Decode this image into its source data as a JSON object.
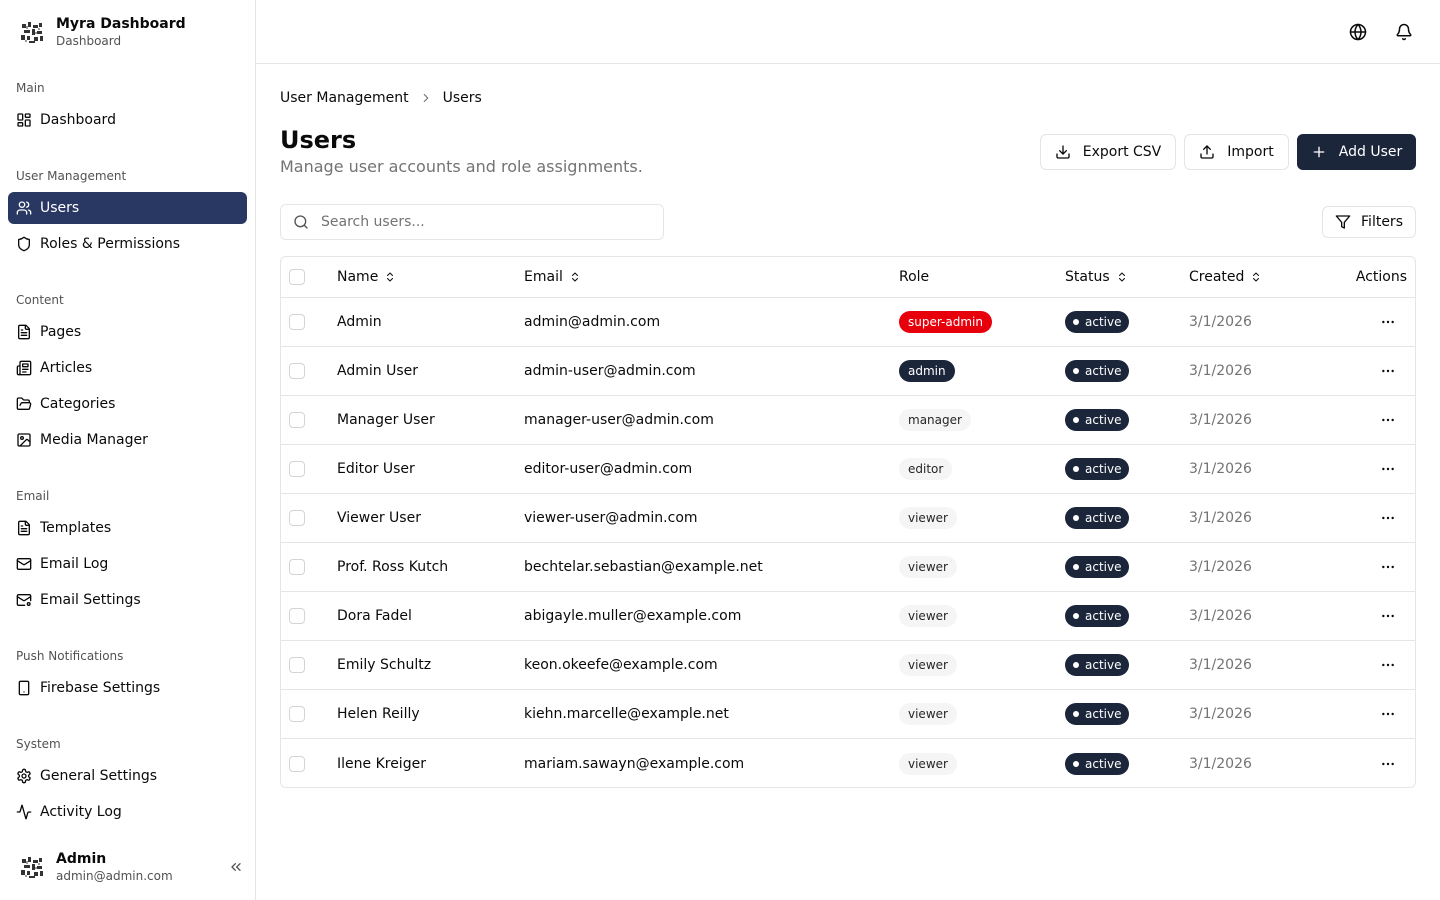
{
  "sidebar": {
    "brand": {
      "title": "Myra Dashboard",
      "subtitle": "Dashboard"
    },
    "groups": [
      {
        "label": "Main"
      },
      {
        "label": "User Management"
      },
      {
        "label": "Content"
      },
      {
        "label": "Email"
      },
      {
        "label": "Push Notifications"
      },
      {
        "label": "System"
      }
    ],
    "items": [
      {
        "label": "Dashboard",
        "icon": "layout-grid-icon"
      },
      {
        "label": "Users",
        "icon": "users-icon",
        "active": true
      },
      {
        "label": "Roles & Permissions",
        "icon": "shield-icon"
      },
      {
        "label": "Pages",
        "icon": "file-text-icon"
      },
      {
        "label": "Articles",
        "icon": "newspaper-icon"
      },
      {
        "label": "Categories",
        "icon": "folder-open-icon"
      },
      {
        "label": "Media Manager",
        "icon": "image-icon"
      },
      {
        "label": "Templates",
        "icon": "file-text-icon"
      },
      {
        "label": "Email Log",
        "icon": "mail-icon"
      },
      {
        "label": "Email Settings",
        "icon": "mail-settings-icon"
      },
      {
        "label": "Firebase Settings",
        "icon": "smartphone-icon"
      },
      {
        "label": "General Settings",
        "icon": "gear-icon"
      },
      {
        "label": "Activity Log",
        "icon": "activity-icon"
      }
    ],
    "user": {
      "name": "Admin",
      "email": "admin@admin.com"
    }
  },
  "breadcrumb": {
    "parent": "User Management",
    "current": "Users"
  },
  "page": {
    "title": "Users",
    "description": "Manage user accounts and role assignments."
  },
  "actions": {
    "export": "Export CSV",
    "import": "Import",
    "add": "Add User"
  },
  "search": {
    "placeholder": "Search users...",
    "value": ""
  },
  "filters_label": "Filters",
  "table": {
    "columns": {
      "name": "Name",
      "email": "Email",
      "role": "Role",
      "status": "Status",
      "created": "Created",
      "actions": "Actions"
    },
    "rows": [
      {
        "name": "Admin",
        "email": "admin@admin.com",
        "role": "super-admin",
        "status": "active",
        "created": "3/1/2026"
      },
      {
        "name": "Admin User",
        "email": "admin-user@admin.com",
        "role": "admin",
        "status": "active",
        "created": "3/1/2026"
      },
      {
        "name": "Manager User",
        "email": "manager-user@admin.com",
        "role": "manager",
        "status": "active",
        "created": "3/1/2026"
      },
      {
        "name": "Editor User",
        "email": "editor-user@admin.com",
        "role": "editor",
        "status": "active",
        "created": "3/1/2026"
      },
      {
        "name": "Viewer User",
        "email": "viewer-user@admin.com",
        "role": "viewer",
        "status": "active",
        "created": "3/1/2026"
      },
      {
        "name": "Prof. Ross Kutch",
        "email": "bechtelar.sebastian@example.net",
        "role": "viewer",
        "status": "active",
        "created": "3/1/2026"
      },
      {
        "name": "Dora Fadel",
        "email": "abigayle.muller@example.com",
        "role": "viewer",
        "status": "active",
        "created": "3/1/2026"
      },
      {
        "name": "Emily Schultz",
        "email": "keon.okeefe@example.com",
        "role": "viewer",
        "status": "active",
        "created": "3/1/2026"
      },
      {
        "name": "Helen Reilly",
        "email": "kiehn.marcelle@example.net",
        "role": "viewer",
        "status": "active",
        "created": "3/1/2026"
      },
      {
        "name": "Ilene Kreiger",
        "email": "mariam.sawayn@example.com",
        "role": "viewer",
        "status": "active",
        "created": "3/1/2026"
      }
    ]
  },
  "colors": {
    "sidebar_active": "#283862",
    "primary": "#1b263b",
    "super_admin": "#e7000b"
  }
}
